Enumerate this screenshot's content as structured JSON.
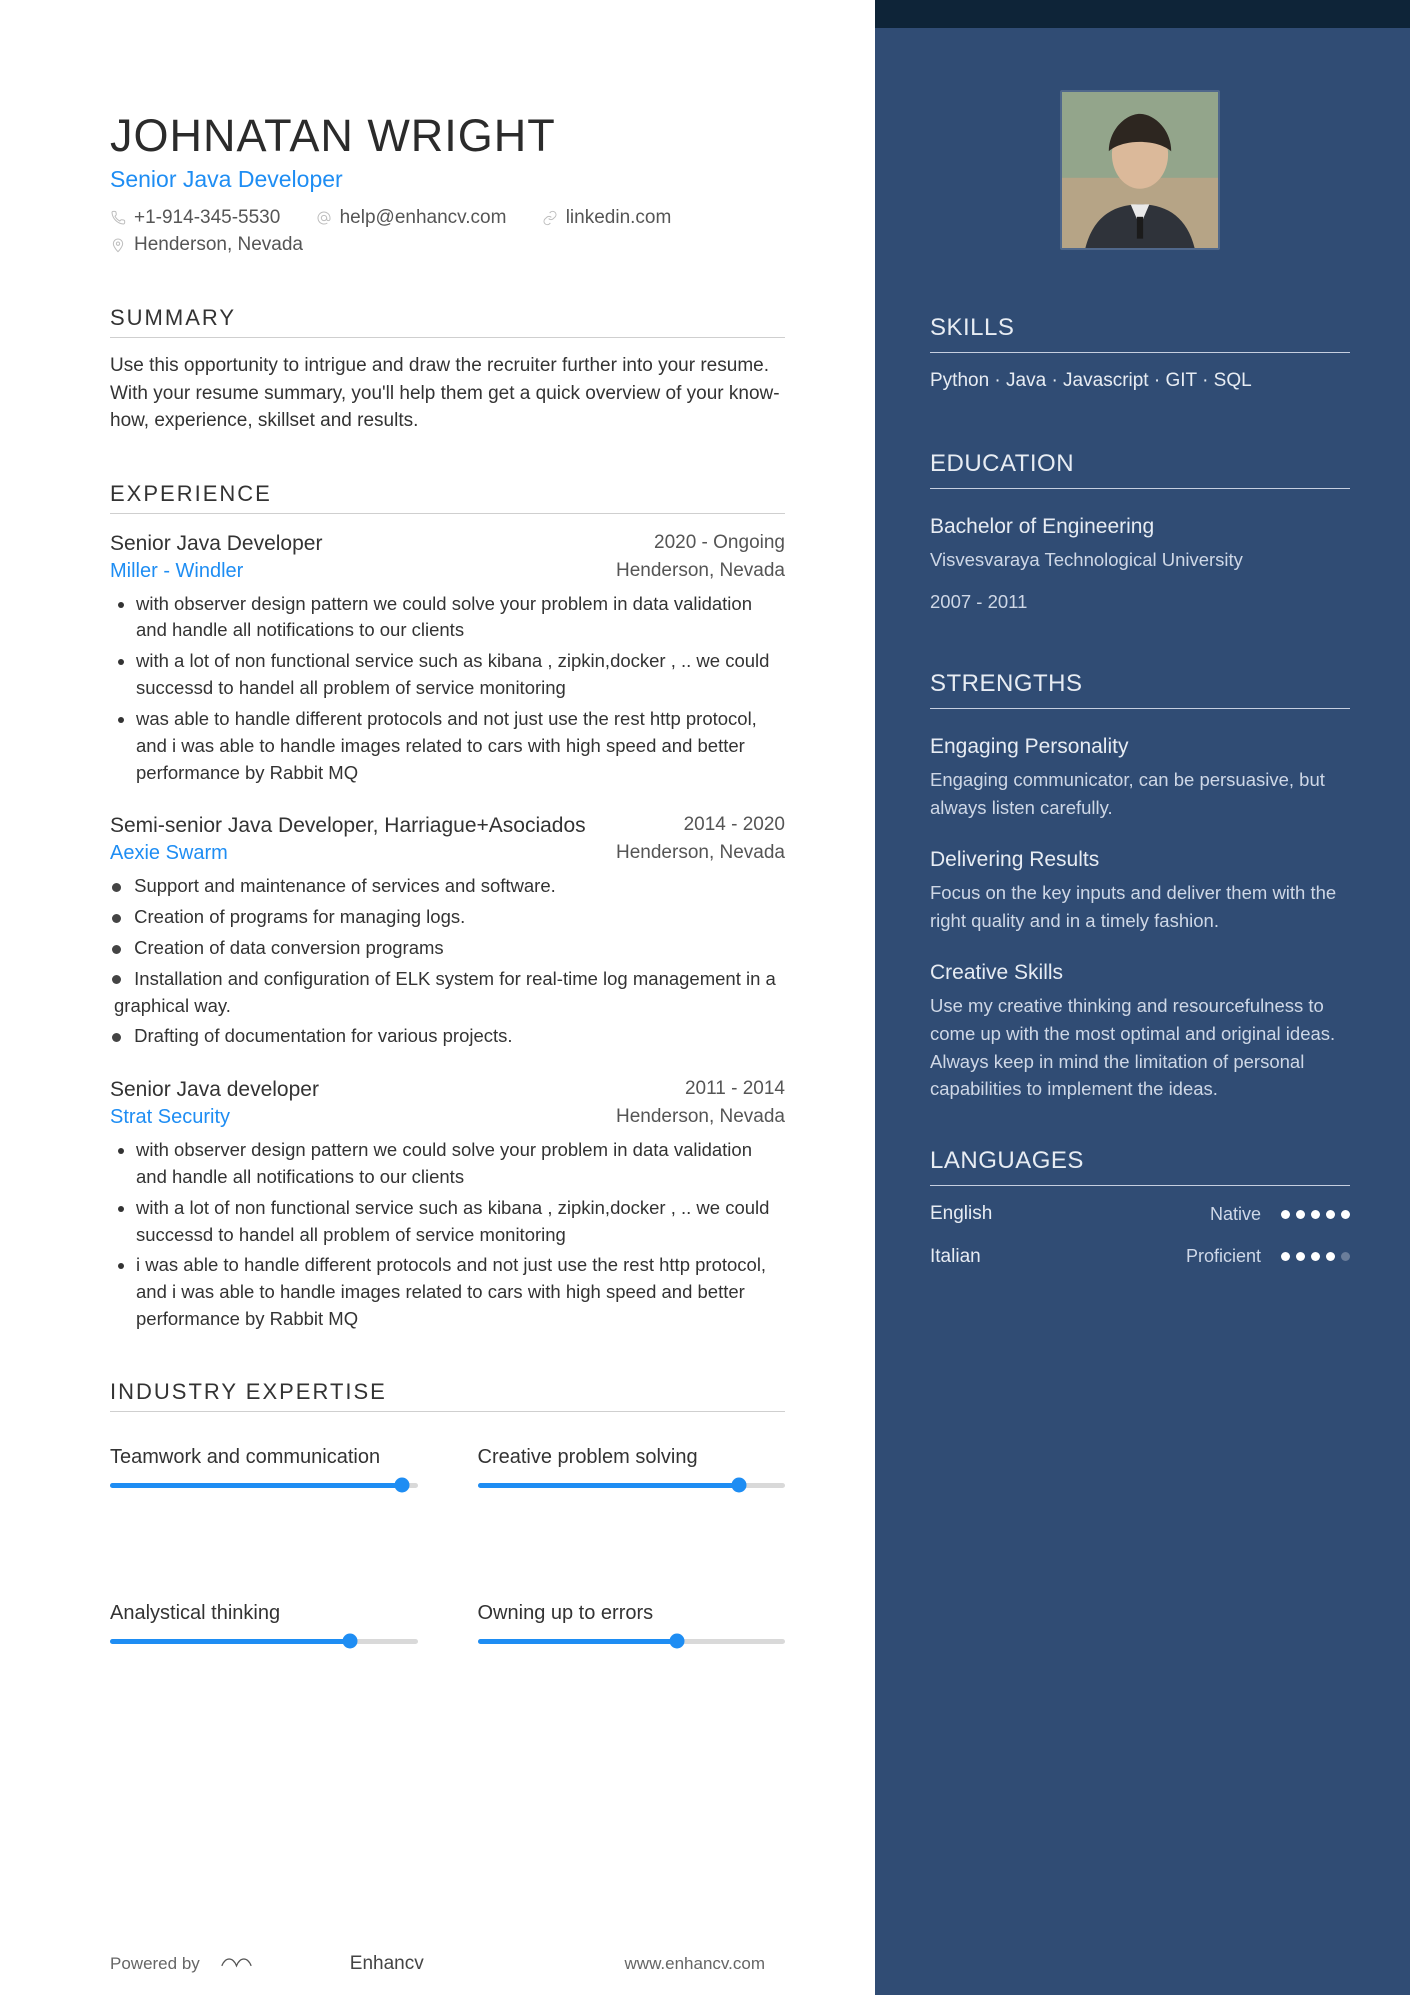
{
  "header": {
    "name": "JOHNATAN WRIGHT",
    "role": "Senior Java Developer",
    "phone": "+1-914-345-5530",
    "email": "help@enhancv.com",
    "link": "linkedin.com",
    "location": "Henderson, Nevada"
  },
  "summary": {
    "heading": "SUMMARY",
    "text": "Use this opportunity to intrigue and draw the recruiter further into your resume. With your resume summary, you'll help them get a quick overview of your know-how, experience, skillset and results."
  },
  "experience": {
    "heading": "EXPERIENCE",
    "items": [
      {
        "title": "Senior Java Developer",
        "company": "Miller - Windler",
        "date": "2020 - Ongoing",
        "location": "Henderson, Nevada",
        "bullets": [
          "with observer design pattern we could solve your problem in data validation and handle all notifications to our clients",
          "with a lot of non functional service such as kibana , zipkin,docker , .. we could successd to handel all problem of service monitoring",
          "was able to handle different protocols and not just use the rest http protocol, and i was able to handle images related to cars with high speed and better performance by Rabbit MQ"
        ],
        "solid": false
      },
      {
        "title": "Semi-senior Java Developer, Harriague+Asociados",
        "company": "Aexie Swarm",
        "date": "2014 - 2020",
        "location": "Henderson, Nevada",
        "bullets": [
          "Support and maintenance of services and software.",
          "Creation of programs for managing logs.",
          "Creation of data conversion programs",
          "Installation and configuration of ELK system for real-time log management in a graphical way.",
          "Drafting of documentation for various projects."
        ],
        "solid": true
      },
      {
        "title": "Senior Java developer",
        "company": "Strat Security",
        "date": "2011 - 2014",
        "location": "Henderson, Nevada",
        "bullets": [
          "with observer design pattern we could solve your problem in data validation and handle all notifications to our clients",
          "with a lot of non functional service such as kibana , zipkin,docker , .. we could successd to handel all problem of service monitoring",
          "i was able to handle different protocols and not just use the rest http protocol, and i was able to handle images related to cars with high speed and better performance by Rabbit MQ"
        ],
        "solid": false
      }
    ]
  },
  "expertise": {
    "heading": "INDUSTRY EXPERTISE",
    "items": [
      {
        "label": "Teamwork and communication",
        "value": 0.95
      },
      {
        "label": "Creative problem solving",
        "value": 0.85
      },
      {
        "label": "Analystical thinking",
        "value": 0.78
      },
      {
        "label": "Owning up to errors",
        "value": 0.65
      }
    ]
  },
  "sidebar": {
    "skills": {
      "heading": "SKILLS",
      "text": "Python · Java · Javascript · GIT · SQL"
    },
    "education": {
      "heading": "EDUCATION",
      "degree": "Bachelor of Engineering",
      "school": "Visvesvaraya Technological University",
      "dates": "2007 - 2011"
    },
    "strengths": {
      "heading": "STRENGTHS",
      "items": [
        {
          "title": "Engaging Personality",
          "body": "Engaging communicator, can be persuasive, but always listen carefully."
        },
        {
          "title": "Delivering Results",
          "body": "Focus on the key inputs and deliver them with the right quality and in a timely fashion."
        },
        {
          "title": "Creative Skills",
          "body": "Use my creative thinking and resourcefulness to come up with the most optimal and original ideas. Always keep in mind the limitation of personal capabilities to implement the ideas."
        }
      ]
    },
    "languages": {
      "heading": "LANGUAGES",
      "items": [
        {
          "name": "English",
          "level": "Native",
          "score": 5
        },
        {
          "name": "Italian",
          "level": "Proficient",
          "score": 4
        }
      ]
    }
  },
  "footer": {
    "powered": "Powered by",
    "brand": "Enhancv",
    "url": "www.enhancv.com"
  }
}
